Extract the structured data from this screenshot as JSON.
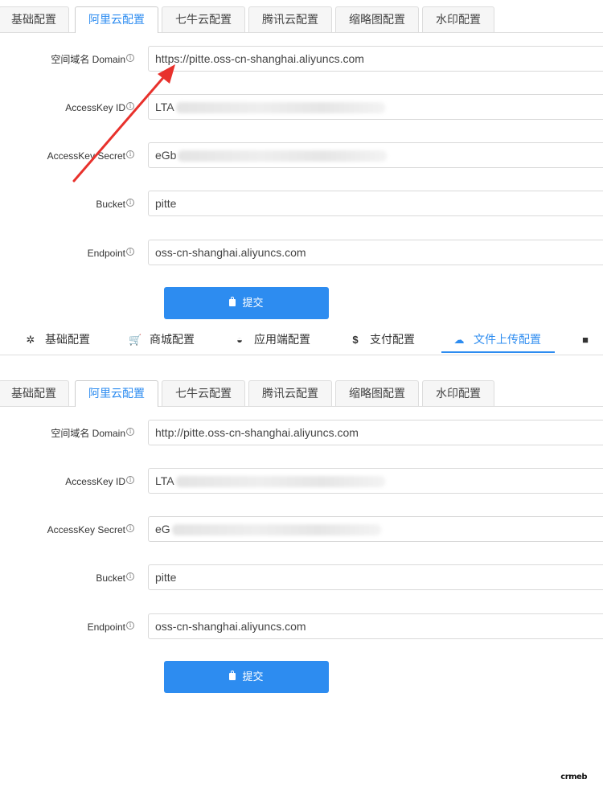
{
  "tabs": [
    "基础配置",
    "阿里云配置",
    "七牛云配置",
    "腾讯云配置",
    "缩略图配置",
    "水印配置"
  ],
  "active_tab": "阿里云配置",
  "form_top": {
    "fields": [
      {
        "label": "空间域名 Domain",
        "value": "https://pitte.oss-cn-shanghai.aliyuncs.com"
      },
      {
        "label": "AccessKey ID",
        "value": "LTA"
      },
      {
        "label": "AccessKey Secret",
        "value": "eGb"
      },
      {
        "label": "Bucket",
        "value": "pitte"
      },
      {
        "label": "Endpoint",
        "value": "oss-cn-shanghai.aliyuncs.com"
      }
    ],
    "submit_label": "提交"
  },
  "nav": {
    "items": [
      {
        "label": "基础配置",
        "icon": "gear-icon"
      },
      {
        "label": "商城配置",
        "icon": "cart-icon"
      },
      {
        "label": "应用端配置",
        "icon": "chart-icon"
      },
      {
        "label": "支付配置",
        "icon": "dollar-icon"
      },
      {
        "label": "文件上传配置",
        "icon": "cloud-upload-icon"
      },
      {
        "label": "",
        "icon": "briefcase-icon"
      }
    ],
    "active": "文件上传配置"
  },
  "form_bottom": {
    "fields": [
      {
        "label": "空间域名 Domain",
        "value": "http://pitte.oss-cn-shanghai.aliyuncs.com"
      },
      {
        "label": "AccessKey ID",
        "value": "LTA"
      },
      {
        "label": "AccessKey Secret",
        "value": "eG"
      },
      {
        "label": "Bucket",
        "value": "pitte"
      },
      {
        "label": "Endpoint",
        "value": "oss-cn-shanghai.aliyuncs.com"
      }
    ],
    "submit_label": "提交"
  },
  "watermark": "crmeb",
  "colors": {
    "accent": "#2d8cf0",
    "arrow": "#e8312c"
  }
}
